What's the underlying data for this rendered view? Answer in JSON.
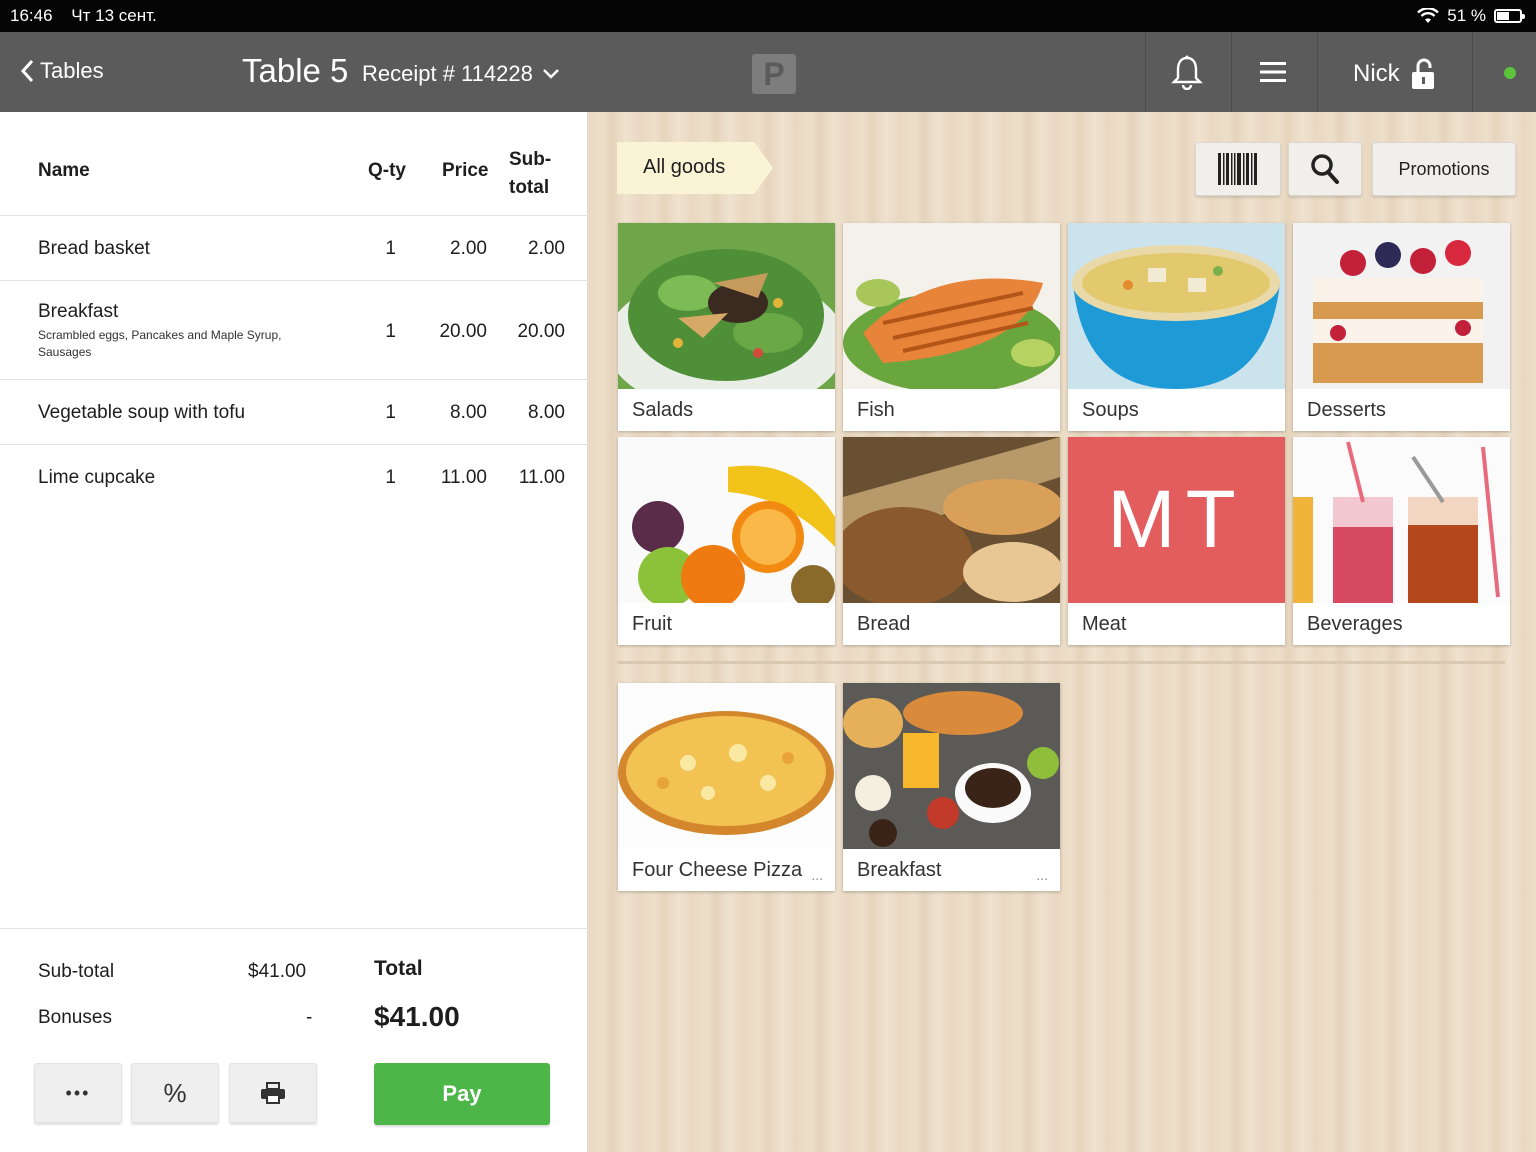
{
  "status": {
    "time": "16:46",
    "date": "Чт 13 сент.",
    "battery": "51 %",
    "battery_level": 0.51
  },
  "nav": {
    "back_label": "Tables",
    "title": "Table 5",
    "receipt": "Receipt # 114228",
    "logo": "P",
    "user": "Nick"
  },
  "order": {
    "headers": {
      "name": "Name",
      "qty": "Q-ty",
      "price": "Price",
      "sub1": "Sub-",
      "sub2": "total"
    },
    "items": [
      {
        "name": "Bread basket",
        "desc": "",
        "qty": "1",
        "price": "2.00",
        "subtotal": "2.00"
      },
      {
        "name": "Breakfast",
        "desc": "Scrambled eggs, Pancakes and Maple Syrup, Sausages",
        "qty": "1",
        "price": "20.00",
        "subtotal": "20.00"
      },
      {
        "name": "Vegetable soup with tofu",
        "desc": "",
        "qty": "1",
        "price": "8.00",
        "subtotal": "8.00"
      },
      {
        "name": "Lime cupcake",
        "desc": "",
        "qty": "1",
        "price": "11.00",
        "subtotal": "11.00"
      }
    ],
    "subtotal_label": "Sub-total",
    "subtotal_value": "$41.00",
    "bonuses_label": "Bonuses",
    "bonuses_value": "-",
    "total_label": "Total",
    "total_value": "$41.00",
    "more_label": "•••",
    "discount_label": "%",
    "pay_label": "Pay"
  },
  "catalog": {
    "breadcrumb": "All goods",
    "promotions_label": "Promotions",
    "categories": [
      {
        "label": "Salads"
      },
      {
        "label": "Fish"
      },
      {
        "label": "Soups"
      },
      {
        "label": "Desserts"
      },
      {
        "label": "Fruit"
      },
      {
        "label": "Bread"
      },
      {
        "label": "Meat",
        "initials": "MT"
      },
      {
        "label": "Beverages"
      }
    ],
    "products": [
      {
        "label": "Four Cheese Pizza",
        "more": "..."
      },
      {
        "label": "Breakfast",
        "more": "..."
      }
    ]
  },
  "colors": {
    "pay": "#4cb748",
    "meat_tile": "#e35d5f",
    "online": "#5cc33d",
    "nav": "#5b5b5b"
  }
}
